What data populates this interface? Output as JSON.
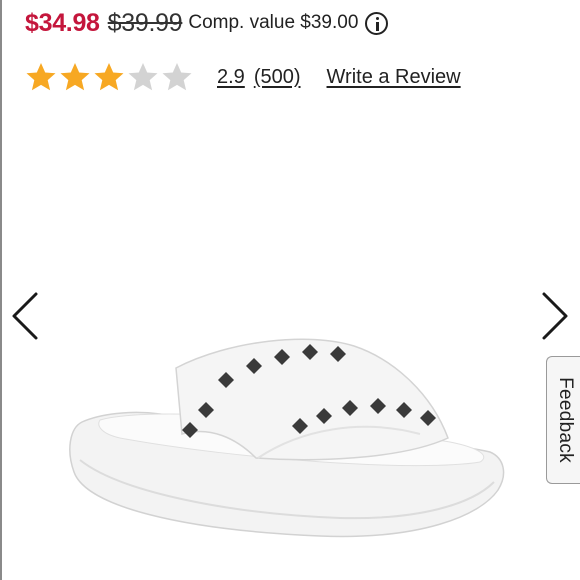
{
  "pricing": {
    "sale_price": "$34.98",
    "original_price": "$39.99",
    "comp_value_text": "Comp. value $39.00",
    "info_icon": "info-circle-icon",
    "sale_color": "#c4163c"
  },
  "rating": {
    "value": 2.9,
    "value_text": "2.9",
    "review_count_text": "(500)",
    "write_review_label": "Write a Review",
    "stars_filled": 3,
    "stars_total": 5,
    "star_color": "#f7a823",
    "star_empty_color": "#d3d3d3"
  },
  "carousel": {
    "prev_icon": "chevron-left-icon",
    "next_icon": "chevron-right-icon"
  },
  "feedback": {
    "label": "Feedback"
  }
}
